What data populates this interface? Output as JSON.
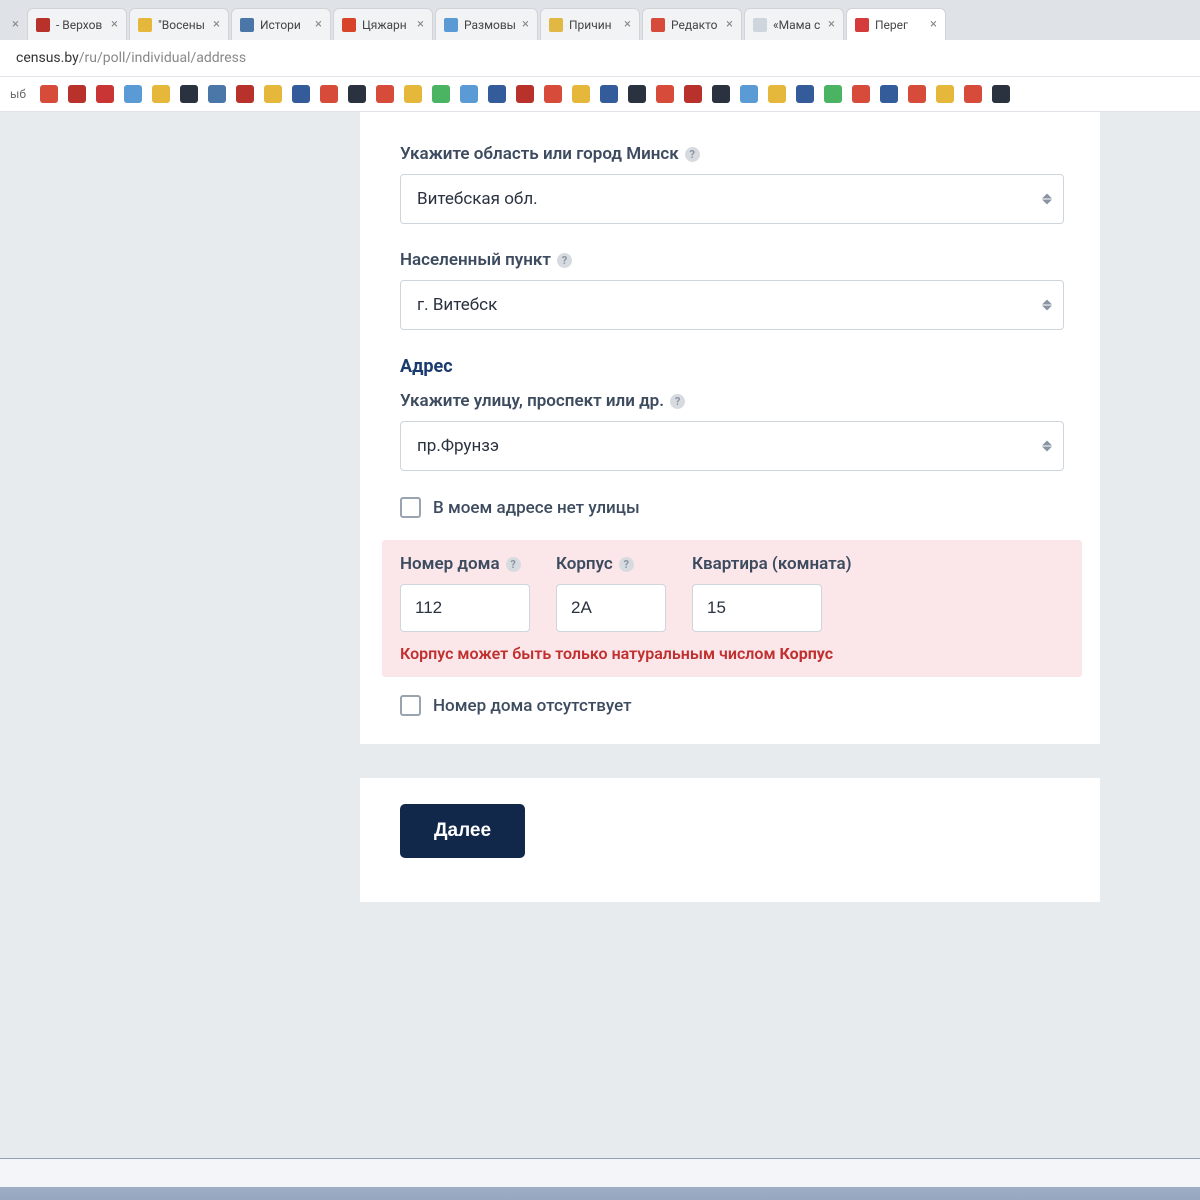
{
  "browser": {
    "tabs": [
      {
        "label": "- Верхов",
        "icon": "#b8312b"
      },
      {
        "label": "\"Восены",
        "icon": "#e5b73b"
      },
      {
        "label": "Истори",
        "icon": "#4a76a8"
      },
      {
        "label": "Цяжарн",
        "icon": "#d8442a"
      },
      {
        "label": "Размовы",
        "icon": "#5a9bd5"
      },
      {
        "label": "Причин",
        "icon": "#e2b844"
      },
      {
        "label": "Редакто",
        "icon": "#d64b3a"
      },
      {
        "label": "«Мама с",
        "icon": "#cfd5dd"
      },
      {
        "label": "Перег",
        "icon": "#d63b3b",
        "active": true
      }
    ],
    "url_host": "census.by",
    "url_path": "/ru/poll/individual/address",
    "bookmarks_label": "ыб"
  },
  "form": {
    "region_label": "Укажите область или город Минск",
    "region_value": "Витебская обл.",
    "locality_label": "Населенный пункт",
    "locality_value": "г. Витебск",
    "address_heading": "Адрес",
    "street_label": "Укажите улицу, проспект или др.",
    "street_value": "пр.Фрунзэ",
    "no_street_label": "В моем адресе нет улицы",
    "house_label": "Номер дома",
    "house_value": "112",
    "korpus_label": "Корпус",
    "korpus_value": "2А",
    "apt_label": "Квартира (комната)",
    "apt_value": "15",
    "error_text": "Корпус может быть только натуральным числом ",
    "error_field": "Корпус",
    "no_house_label": "Номер дома отсутствует",
    "next_button": "Далее"
  },
  "bookmark_colors": [
    "#d64b3a",
    "#b8312b",
    "#c93434",
    "#5a9bd5",
    "#e5b73b",
    "#2a3240",
    "#4a76a8",
    "#b8312b",
    "#e5b73b",
    "#355c9a",
    "#d64b3a",
    "#2a3240",
    "#d64b3a",
    "#e5b73b",
    "#4bb463",
    "#5a9bd5",
    "#355c9a",
    "#b8312b",
    "#d64b3a",
    "#e5b73b",
    "#355c9a",
    "#2a3240",
    "#d64b3a",
    "#b8312b",
    "#2a3240",
    "#5a9bd5",
    "#e5b73b",
    "#355c9a",
    "#4bb463",
    "#d64b3a",
    "#355c9a",
    "#d64b3a",
    "#e5b73b",
    "#d64b3a",
    "#2a3240"
  ]
}
